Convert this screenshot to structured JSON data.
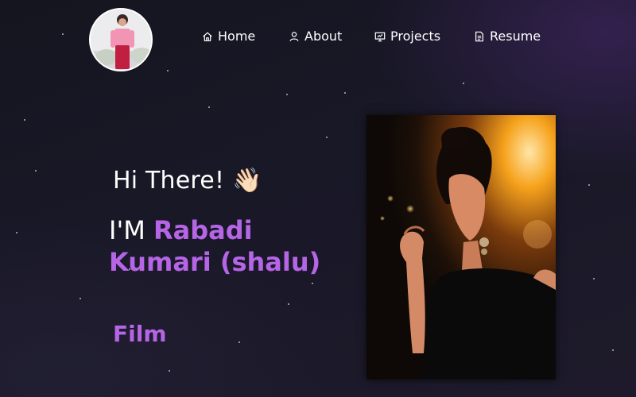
{
  "navbar": {
    "items": [
      {
        "label": "Home",
        "icon": "home-icon"
      },
      {
        "label": "About",
        "icon": "user-icon"
      },
      {
        "label": "Projects",
        "icon": "projects-icon"
      },
      {
        "label": "Resume",
        "icon": "document-icon"
      }
    ]
  },
  "hero": {
    "greeting": "Hi There!",
    "wave": "👋🏻",
    "intro_prefix": "I'M ",
    "name": "Rabadi Kumari (shalu)",
    "role": "Film"
  },
  "colors": {
    "accent": "#b565e6",
    "background": "#181826",
    "text": "#ffffff"
  }
}
